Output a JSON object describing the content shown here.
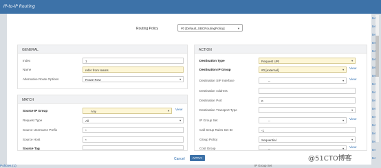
{
  "window": {
    "title": "IP-to-IP Routing"
  },
  "routing_policy": {
    "label": "Routing Policy",
    "value": "#0 [Default_SBCRoutingPolicy]"
  },
  "general": {
    "header": "GENERAL",
    "index": {
      "label": "Index",
      "value": "1"
    },
    "name": {
      "label": "Name",
      "value": "refer from teams"
    },
    "alt_route": {
      "label": "Alternative Route Options",
      "value": "Route Row"
    }
  },
  "match": {
    "header": "MATCH",
    "source_ip_group": {
      "label": "Source IP Group",
      "value": "Any",
      "view": "View"
    },
    "request_type": {
      "label": "Request Type",
      "value": "All"
    },
    "source_username_prefix": {
      "label": "Source Username Prefix",
      "value": "*"
    },
    "source_host": {
      "label": "Source Host",
      "value": "*"
    },
    "source_tag": {
      "label": "Source Tag",
      "value": ""
    }
  },
  "action": {
    "header": "ACTION",
    "destination_type": {
      "label": "Destination Type",
      "value": "Request URI"
    },
    "destination_ip_group": {
      "label": "Destination IP Group",
      "value": "#0 [external]",
      "view": "View"
    },
    "destination_sip_interface": {
      "label": "Destination SIP Interface",
      "value": "--",
      "view": "View"
    },
    "destination_address": {
      "label": "Destination Address",
      "value": ""
    },
    "destination_port": {
      "label": "Destination Port",
      "value": "0"
    },
    "destination_transport_type": {
      "label": "Destination Transport Type",
      "value": ""
    },
    "ip_group_set": {
      "label": "IP Group Set",
      "value": "--",
      "view": "View"
    },
    "call_setup_rules_set_id": {
      "label": "Call Setup Rules Set ID",
      "value": "-1"
    },
    "group_policy": {
      "label": "Group Policy",
      "value": "Sequential"
    },
    "cost_group": {
      "label": "Cost Group",
      "value": "--",
      "view": "View"
    }
  },
  "buttons": {
    "cancel": "Cancel",
    "apply": "APPLY"
  },
  "background": {
    "bottom_left": "Policies (1)",
    "bottom_right": "IP Group Set",
    "right_links": [
      "ter",
      "ter",
      "ter",
      "ter",
      "ter",
      "ter",
      "ter",
      "ter",
      "ter",
      "ter",
      "ter",
      "ter",
      "ter",
      "ter",
      "ter",
      "ter",
      "ter",
      "ter"
    ]
  },
  "watermark": "@51CTO博客",
  "colors": {
    "titlebar": "#3d72a8",
    "link": "#2b6cb0",
    "required_field": "#fdf6d6"
  }
}
